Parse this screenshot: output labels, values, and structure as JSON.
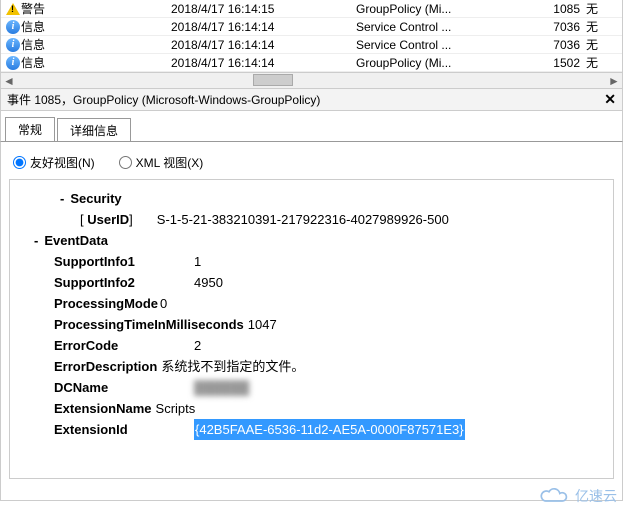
{
  "list": {
    "rows": [
      {
        "icon": "warn",
        "level": "警告",
        "date": "2018/4/17 16:14:15",
        "source": "GroupPolicy (Mi...",
        "id": "1085",
        "task": "无"
      },
      {
        "icon": "info",
        "level": "信息",
        "date": "2018/4/17 16:14:14",
        "source": "Service Control ...",
        "id": "7036",
        "task": "无"
      },
      {
        "icon": "info",
        "level": "信息",
        "date": "2018/4/17 16:14:14",
        "source": "Service Control ...",
        "id": "7036",
        "task": "无"
      },
      {
        "icon": "info",
        "level": "信息",
        "date": "2018/4/17 16:14:14",
        "source": "GroupPolicy (Mi...",
        "id": "1502",
        "task": "无"
      }
    ]
  },
  "detail": {
    "title": "事件 1085，GroupPolicy (Microsoft-Windows-GroupPolicy)"
  },
  "tabs": {
    "general": "常规",
    "details": "详细信息"
  },
  "radios": {
    "friendly": "友好视图(N)",
    "xml": "XML 视图(X)"
  },
  "security": {
    "header": "Security",
    "userid_label": "UserID",
    "userid_value": "S-1-5-21-383210391-217922316-4027989926-500"
  },
  "eventdata": {
    "header": "EventData",
    "SupportInfo1": "1",
    "SupportInfo2": "4950",
    "ProcessingMode": "0",
    "ProcessingTimeInMilliseconds": "1047",
    "ErrorCode": "2",
    "ErrorDescription": "系统找不到指定的文件。",
    "DCName": "",
    "ExtensionName": "Scripts",
    "ExtensionId": "{42B5FAAE-6536-11d2-AE5A-0000F87571E3}"
  },
  "labels": {
    "SupportInfo1": "SupportInfo1",
    "SupportInfo2": "SupportInfo2",
    "ProcessingMode": "ProcessingMode",
    "ProcessingTimeInMilliseconds": "ProcessingTimeInMilliseconds",
    "ErrorCode": "ErrorCode",
    "ErrorDescription": "ErrorDescription",
    "DCName": "DCName",
    "ExtensionName": "ExtensionName",
    "ExtensionId": "ExtensionId"
  },
  "watermark": "亿速云"
}
